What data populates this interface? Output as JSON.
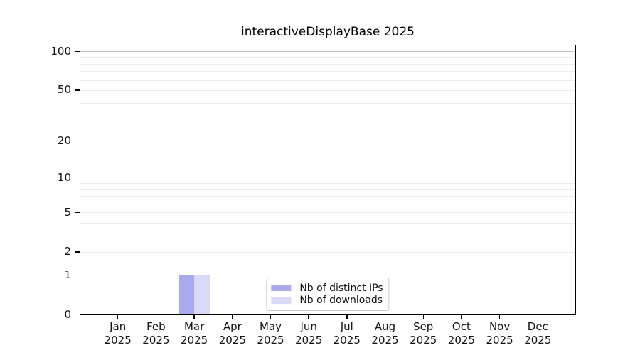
{
  "chart_data": {
    "type": "bar",
    "title": "interactiveDisplayBase 2025",
    "categories": [
      "Jan",
      "Feb",
      "Mar",
      "Apr",
      "May",
      "Jun",
      "Jul",
      "Aug",
      "Sep",
      "Oct",
      "Nov",
      "Dec"
    ],
    "x_year_label": "2025",
    "series": [
      {
        "name": "Nb of distinct IPs",
        "color": "#a9a9ef",
        "values": [
          0,
          0,
          1,
          0,
          0,
          0,
          0,
          0,
          0,
          0,
          0,
          0
        ]
      },
      {
        "name": "Nb of downloads",
        "color": "#d9d9f8",
        "values": [
          0,
          0,
          1,
          0,
          0,
          0,
          0,
          0,
          0,
          0,
          0,
          0
        ]
      }
    ],
    "y_axis": {
      "scale": "log1p",
      "ylim": [
        0,
        112
      ],
      "tick_labels": [
        0,
        1,
        2,
        5,
        10,
        20,
        50,
        100
      ],
      "major_gridlines": [
        1,
        10,
        100
      ],
      "minor_gridlines": [
        2,
        3,
        4,
        5,
        6,
        7,
        8,
        9,
        20,
        30,
        40,
        50,
        60,
        70,
        80,
        90
      ]
    },
    "grid": "horizontal-only",
    "legend_position": "lower-center"
  },
  "colors": {
    "background": "#ffffff",
    "axis": "#000000",
    "major_gridline": "#c2c2c2",
    "minor_gridline": "#ececec",
    "bar_distinct_ips": "#a9a9ef",
    "bar_downloads": "#d9d9f8",
    "legend_border": "#cccccc"
  }
}
